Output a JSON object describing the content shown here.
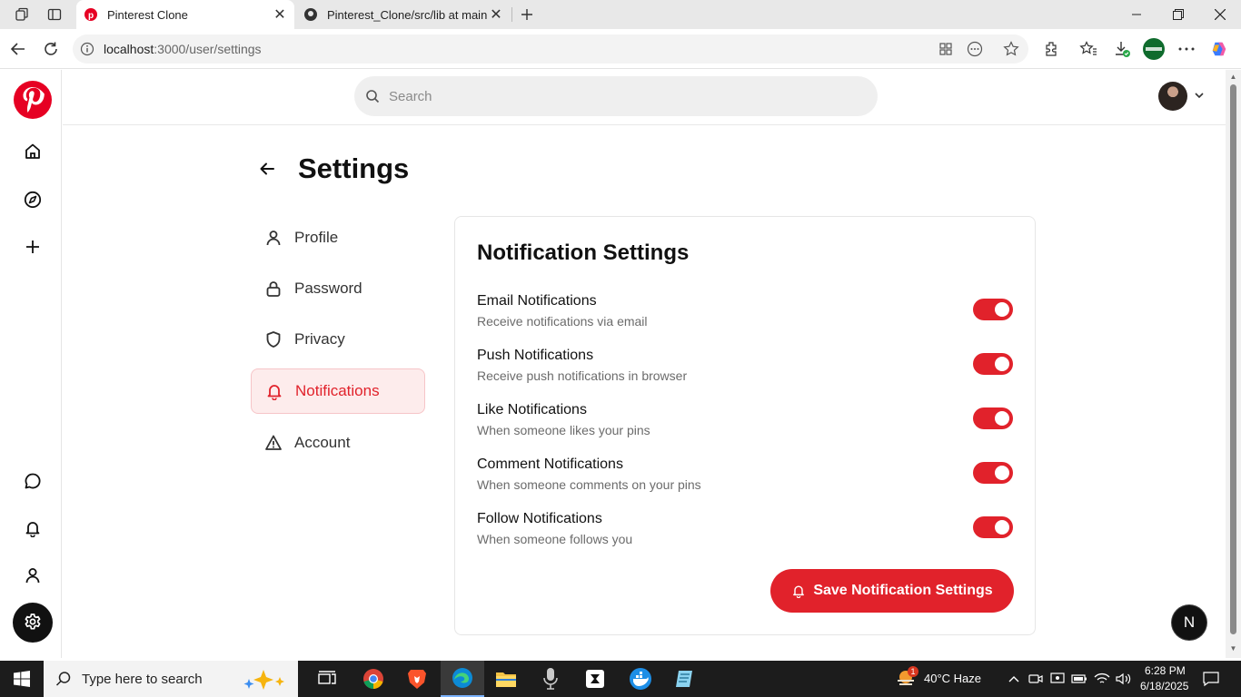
{
  "browser": {
    "tabs": [
      {
        "label": "Pinterest Clone"
      },
      {
        "label": "Pinterest_Clone/src/lib at main · M"
      }
    ],
    "url_host": "localhost",
    "url_rest": ":3000/user/settings"
  },
  "header": {
    "search_placeholder": "Search"
  },
  "settings": {
    "title": "Settings",
    "nav": [
      {
        "label": "Profile",
        "icon": "user-icon"
      },
      {
        "label": "Password",
        "icon": "lock-icon"
      },
      {
        "label": "Privacy",
        "icon": "shield-icon"
      },
      {
        "label": "Notifications",
        "icon": "bell-icon",
        "active": true
      },
      {
        "label": "Account",
        "icon": "warning-icon"
      }
    ]
  },
  "notifications": {
    "title": "Notification Settings",
    "items": [
      {
        "title": "Email Notifications",
        "desc": "Receive notifications via email",
        "enabled": true
      },
      {
        "title": "Push Notifications",
        "desc": "Receive push notifications in browser",
        "enabled": true
      },
      {
        "title": "Like Notifications",
        "desc": "When someone likes your pins",
        "enabled": true
      },
      {
        "title": "Comment Notifications",
        "desc": "When someone comments on your pins",
        "enabled": true
      },
      {
        "title": "Follow Notifications",
        "desc": "When someone follows you",
        "enabled": true
      }
    ],
    "save_label": "Save Notification Settings"
  },
  "dev_badge": "N",
  "taskbar": {
    "search_placeholder": "Type here to search",
    "weather": "40°C  Haze",
    "weather_badge": "1",
    "time": "6:28 PM",
    "date": "6/18/2025"
  },
  "colors": {
    "accent": "#e1222b",
    "brand": "#e60023"
  }
}
